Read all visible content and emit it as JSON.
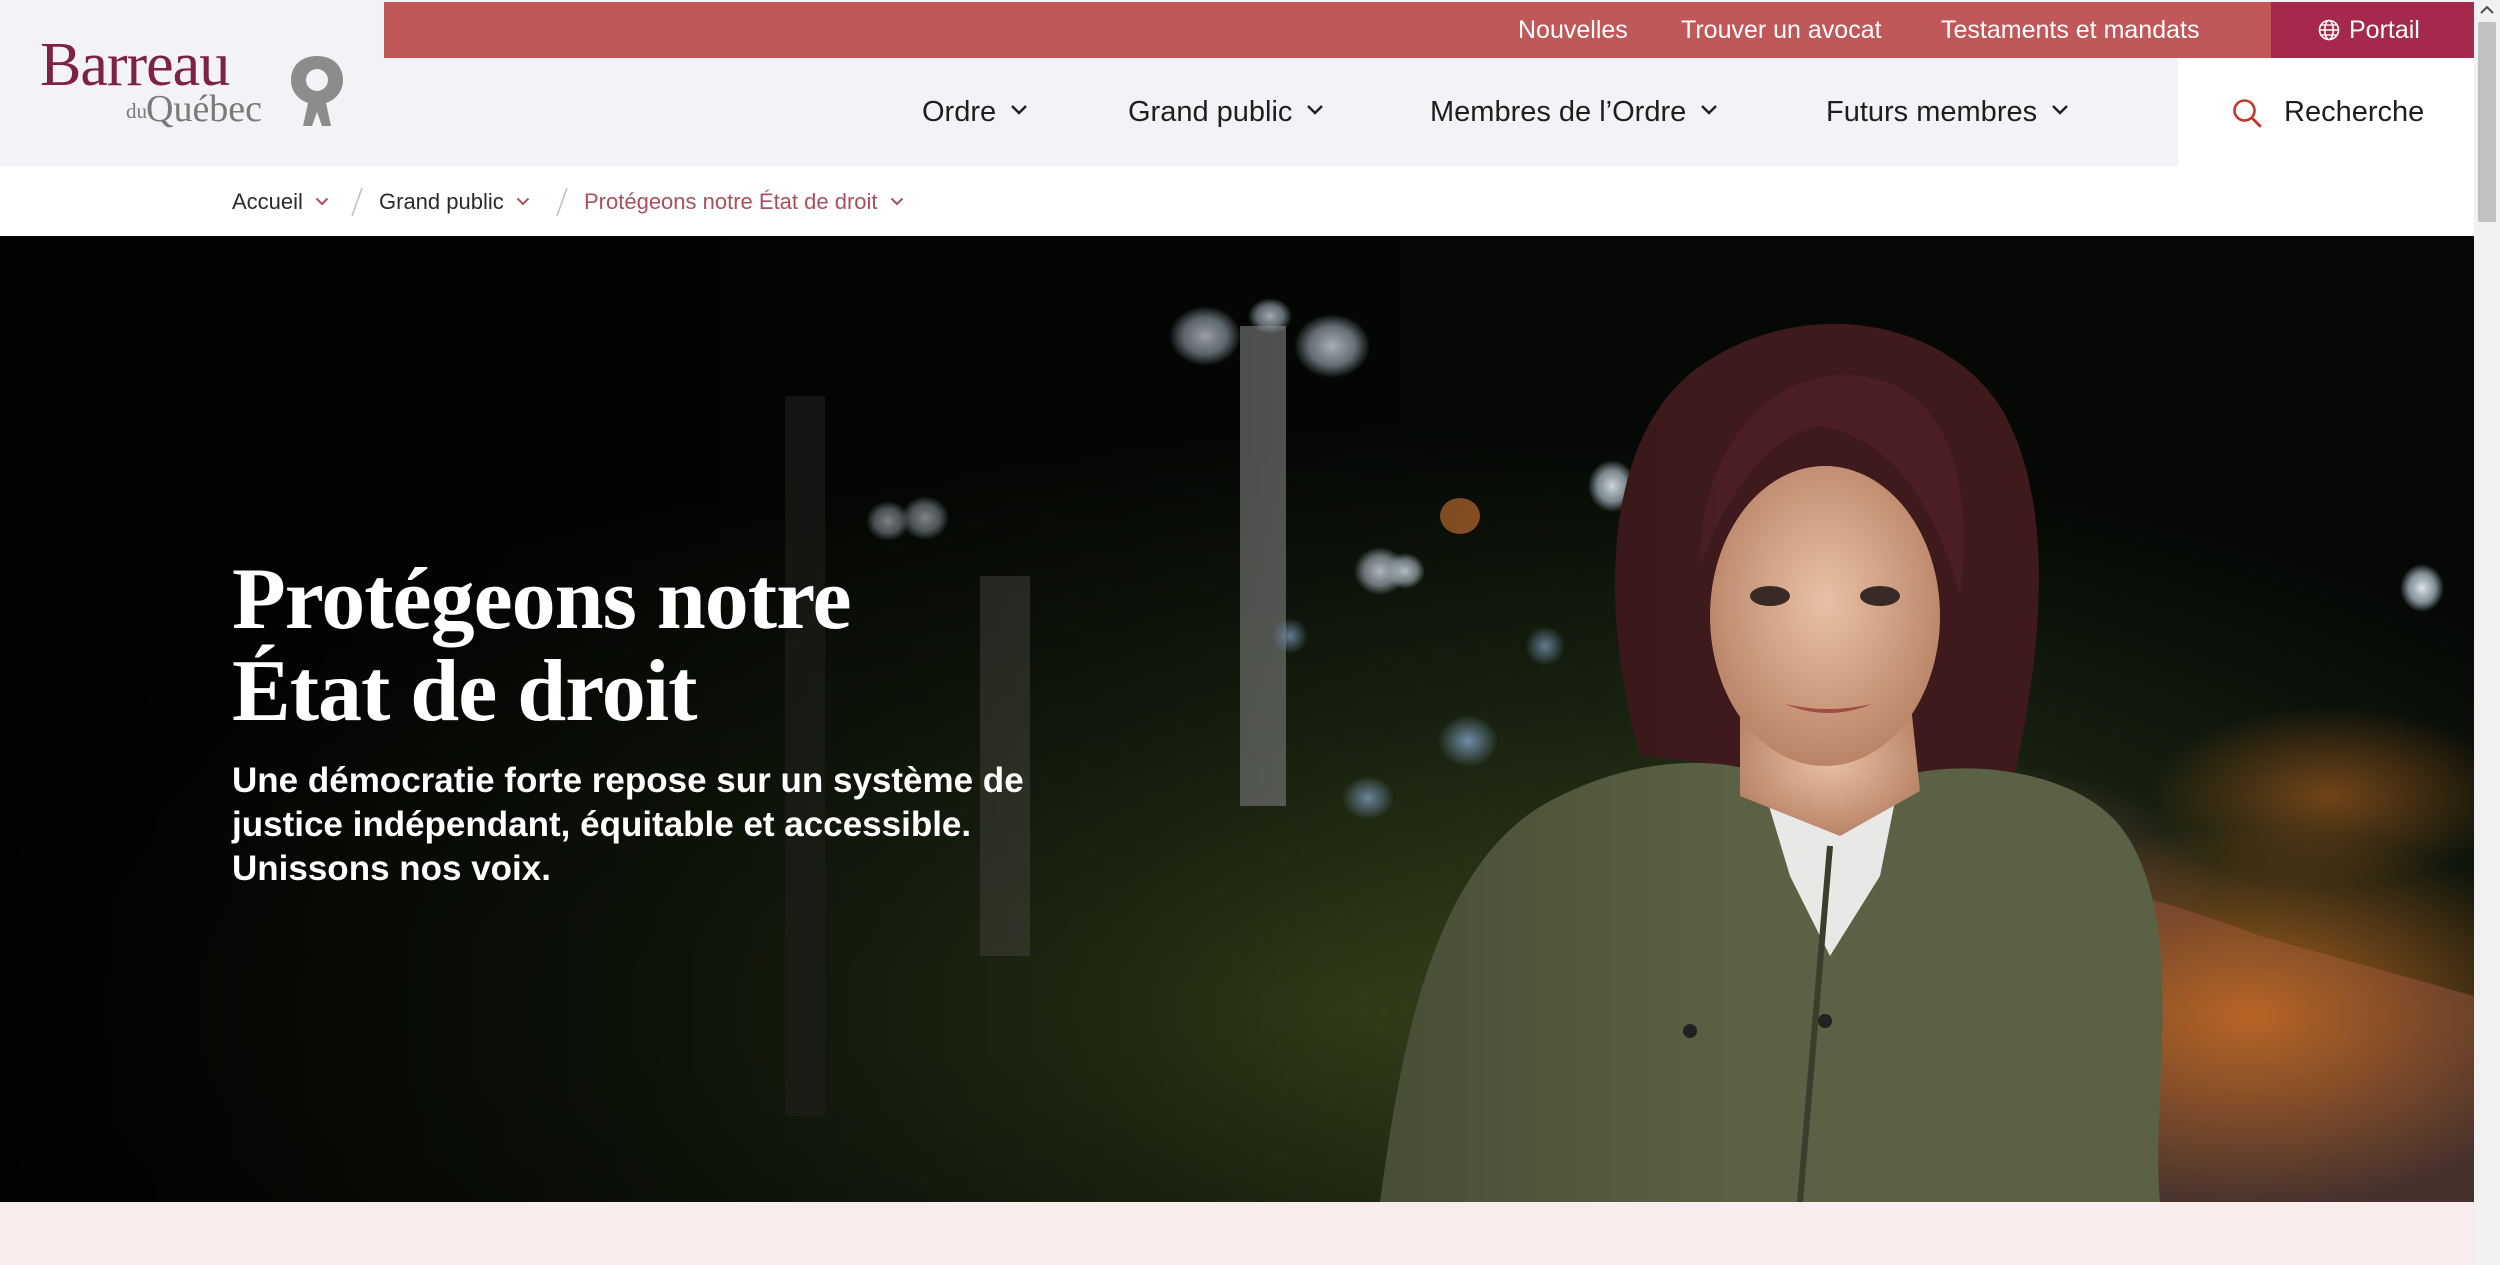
{
  "brand": {
    "logo_word": "Barreau",
    "logo_du": "du",
    "logo_place": "Québec",
    "primary_color": "#7d2145",
    "utility_bar_color": "#c05758",
    "portal_color": "#a5294c"
  },
  "utility_nav": {
    "links": [
      "Nouvelles",
      "Trouver un avocat",
      "Testaments et mandats"
    ],
    "portal_label": "Portail",
    "portal_icon": "globe-icon"
  },
  "main_nav": {
    "items": [
      "Ordre",
      "Grand public",
      "Membres de l’Ordre",
      "Futurs membres"
    ],
    "item_icon": "chevron-down-icon",
    "search_label": "Recherche",
    "search_icon": "search-icon"
  },
  "breadcrumb": {
    "items": [
      "Accueil",
      "Grand public",
      "Protégeons notre État de droit"
    ],
    "current_color": "#a8505e"
  },
  "hero": {
    "title_lines": [
      "Protégeons notre",
      "État de droit"
    ],
    "subtitle_lines": [
      "Une démocratie forte repose sur un système de",
      "justice indépendant, équitable et accessible.",
      "Unissons nos voix."
    ],
    "image_subject": "young woman in green jacket in park at night"
  }
}
